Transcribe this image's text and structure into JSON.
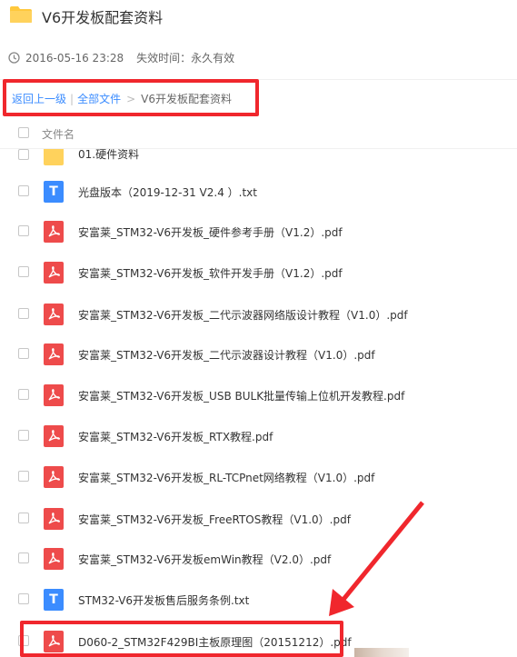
{
  "header": {
    "title": "V6开发板配套资料",
    "folder_icon": "folder-icon"
  },
  "meta": {
    "created": "2016-05-16 23:28",
    "expire_label": "失效时间：永久有效",
    "clock_icon": "clock-icon"
  },
  "breadcrumb": {
    "back": "返回上一级",
    "all_files": "全部文件",
    "separator": ">",
    "current": "V6开发板配套资料"
  },
  "list_header": {
    "name_column": "文件名"
  },
  "files": [
    {
      "name": "01.硬件资料",
      "type": "folder"
    },
    {
      "name": "光盘版本（2019-12-31 V2.4 ）.txt",
      "type": "txt"
    },
    {
      "name": "安富莱_STM32-V6开发板_硬件参考手册（V1.2）.pdf",
      "type": "pdf"
    },
    {
      "name": "安富莱_STM32-V6开发板_软件开发手册（V1.2）.pdf",
      "type": "pdf"
    },
    {
      "name": "安富莱_STM32-V6开发板_二代示波器网络版设计教程（V1.0）.pdf",
      "type": "pdf"
    },
    {
      "name": "安富莱_STM32-V6开发板_二代示波器设计教程（V1.0）.pdf",
      "type": "pdf"
    },
    {
      "name": "安富莱_STM32-V6开发板_USB BULK批量传输上位机开发教程.pdf",
      "type": "pdf"
    },
    {
      "name": "安富莱_STM32-V6开发板_RTX教程.pdf",
      "type": "pdf"
    },
    {
      "name": "安富莱_STM32-V6开发板_RL-TCPnet网络教程（V1.0）.pdf",
      "type": "pdf"
    },
    {
      "name": "安富莱_STM32-V6开发板_FreeRTOS教程（V1.0）.pdf",
      "type": "pdf"
    },
    {
      "name": "安富莱_STM32-V6开发板emWin教程（V2.0）.pdf",
      "type": "pdf"
    },
    {
      "name": "STM32-V6开发板售后服务条例.txt",
      "type": "txt"
    },
    {
      "name": "D060-2_STM32F429BI主板原理图（20151212）.pdf",
      "type": "pdf"
    }
  ],
  "icons": {
    "txt_letter": "T"
  },
  "colors": {
    "accent_blue": "#3b8cff",
    "pdf_red": "#ee4b4b",
    "txt_blue": "#3b8cff",
    "folder_yellow": "#ffd25c",
    "annotation_red": "#f0272d"
  }
}
